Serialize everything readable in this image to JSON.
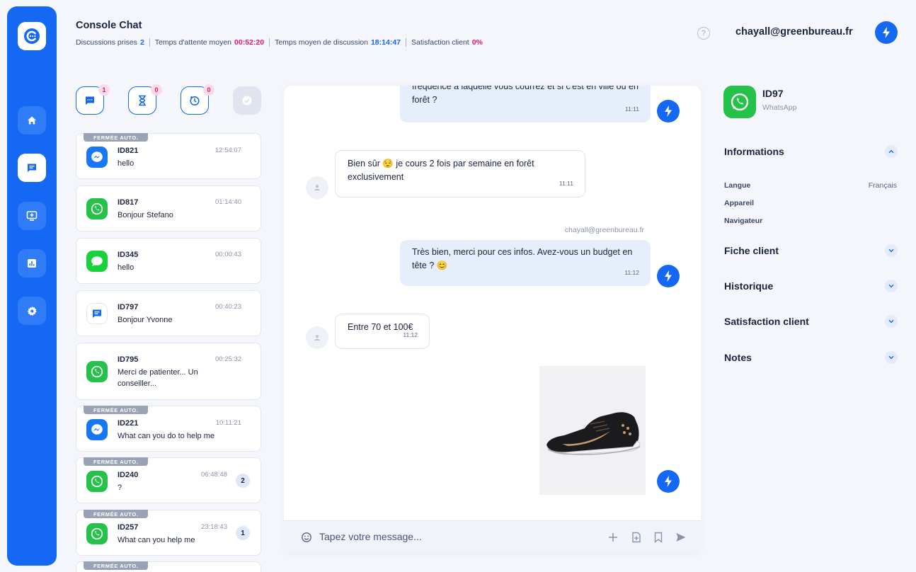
{
  "colors": {
    "primary": "#1468f4",
    "accent_pink": "#e5176e",
    "whatsapp": "#25c24a",
    "messenger": "#1877f2",
    "imessage": "#19d13b"
  },
  "sidebar": {
    "logo": "console-chat-logo-icon",
    "items": [
      {
        "icon": "home-icon",
        "active": false
      },
      {
        "icon": "chat-icon",
        "active": true
      },
      {
        "icon": "screen-plus-icon",
        "active": false
      },
      {
        "icon": "bar-chart-icon",
        "active": false
      },
      {
        "icon": "gear-icon",
        "active": false
      }
    ]
  },
  "header": {
    "title": "Console Chat",
    "stats": [
      {
        "label": "Discussions prises",
        "value": "2",
        "color": "blue"
      },
      {
        "label": "Temps d'attente moyen",
        "value": "00:52:20",
        "color": "pink"
      },
      {
        "label": "Temps moyen de discussion",
        "value": "18:14:47",
        "color": "blue"
      },
      {
        "label": "Satisfaction client",
        "value": "0%",
        "color": "pink"
      }
    ],
    "help_glyph": "?",
    "user_email": "chayall@greenbureau.fr"
  },
  "filters": [
    {
      "icon": "chat-filter-icon",
      "badge": "1"
    },
    {
      "icon": "hourglass-filter-icon",
      "badge": "0"
    },
    {
      "icon": "timer-filter-icon",
      "badge": "0"
    },
    {
      "icon": "check-filter-icon",
      "badge": ""
    }
  ],
  "conversations": {
    "closed_tag": "FERMÉE AUTO.",
    "items": [
      {
        "id": "ID821",
        "time": "12:54:07",
        "message": "hello",
        "channel": "messenger",
        "closed": true,
        "count": ""
      },
      {
        "id": "ID817",
        "time": "01:14:40",
        "message": "Bonjour Stefano",
        "channel": "whatsapp",
        "closed": false,
        "count": ""
      },
      {
        "id": "ID345",
        "time": "00:00:43",
        "message": "hello",
        "channel": "imessage",
        "closed": false,
        "count": ""
      },
      {
        "id": "ID797",
        "time": "00:40:23",
        "message": "Bonjour Yvonne",
        "channel": "webchat",
        "closed": false,
        "count": ""
      },
      {
        "id": "ID795",
        "time": "00:25:32",
        "message": "Merci de patienter... Un conseiller...",
        "channel": "whatsapp",
        "closed": false,
        "count": ""
      },
      {
        "id": "ID221",
        "time": "10:11:21",
        "message": "What can you do to help me",
        "channel": "messenger",
        "closed": true,
        "count": ""
      },
      {
        "id": "ID240",
        "time": "06:48:48",
        "message": "?",
        "channel": "whatsapp",
        "closed": true,
        "count": "2"
      },
      {
        "id": "ID257",
        "time": "23:18:43",
        "message": "What can you help me",
        "channel": "whatsapp",
        "closed": true,
        "count": "1"
      },
      {
        "id": "",
        "time": "",
        "message": "",
        "channel": "",
        "closed": true,
        "count": ""
      }
    ]
  },
  "chat": {
    "messages": [
      {
        "from": "agent",
        "text": "fréquence à laquelle vous courrez et si c'est en ville ou en forêt ?",
        "time": "11:11"
      },
      {
        "from": "client",
        "text": "Bien sûr 😌  je cours 2 fois par semaine en forêt exclusivement",
        "time": "11:11"
      },
      {
        "from": "agent",
        "sender": "chayall@greenbureau.fr",
        "text": "Très bien, merci pour ces infos. Avez-vous un budget en tête ? 😊",
        "time": "11:12"
      },
      {
        "from": "client",
        "text": "Entre 70 et 100€",
        "time": "11:12"
      },
      {
        "from": "agent",
        "image": "running-shoe-image"
      }
    ],
    "composer": {
      "placeholder": "Tapez votre message...",
      "tools": [
        "plus-icon",
        "file-add-icon",
        "bookmark-icon",
        "send-icon"
      ]
    }
  },
  "contact": {
    "id": "ID97",
    "channel": "WhatsApp",
    "sections": [
      {
        "title": "Informations",
        "expanded": true,
        "fields": [
          {
            "label": "Langue",
            "value": "Français"
          },
          {
            "label": "Appareil",
            "value": ""
          },
          {
            "label": "Navigateur",
            "value": ""
          }
        ]
      },
      {
        "title": "Fiche client",
        "expanded": false
      },
      {
        "title": "Historique",
        "expanded": false
      },
      {
        "title": "Satisfaction client",
        "expanded": false
      },
      {
        "title": "Notes",
        "expanded": false
      }
    ]
  }
}
